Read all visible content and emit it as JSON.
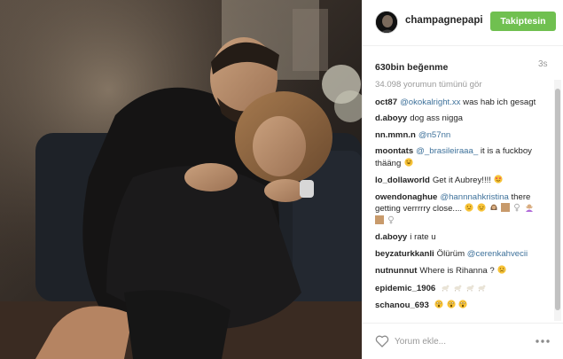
{
  "header": {
    "username": "champagnepapi",
    "follow_label": "Takiptesin"
  },
  "post": {
    "likes": "630bin beğenme",
    "time": "3s",
    "view_all_comments": "34.098 yorumun tümünü gör"
  },
  "comments": [
    {
      "user": "oct87",
      "mention": "@okokalright.xx",
      "text": "was hab ich gesagt"
    },
    {
      "user": "d.aboyy",
      "mention": "",
      "text": "dog ass nigga"
    },
    {
      "user": "nn.mmn.n",
      "mention": "@n57nn",
      "text": ""
    },
    {
      "user": "moontats",
      "mention": "@_brasileiraaa_",
      "text": "it is a fuckboy thääng"
    },
    {
      "user": "lo_dollaworld",
      "mention": "",
      "text": "Get it Aubrey!!!!"
    },
    {
      "user": "owendonaghue",
      "mention": "@hannnahkristina",
      "text": "there getting verrrrry close...."
    },
    {
      "user": "d.aboyy",
      "mention": "",
      "text": "i rate u"
    },
    {
      "user": "beyzaturkkanli",
      "mention": "@cerenkahvecii",
      "text": "Ölürüm"
    },
    {
      "user": "nutnunnut",
      "mention": "",
      "text": "Where is Rihanna ?"
    },
    {
      "user": "epidemic_1906",
      "mention": "",
      "text": ""
    },
    {
      "user": "schanou_693",
      "mention": "",
      "text": ""
    }
  ],
  "footer": {
    "comment_placeholder": "Yorum ekle...",
    "more_label": "•••"
  },
  "colors": {
    "follow_button": "#70c050",
    "mention": "#3f729b",
    "muted": "#999999"
  },
  "icons": {
    "heart": "heart-outline-icon",
    "more": "more-options-icon",
    "avatar": "avatar"
  }
}
